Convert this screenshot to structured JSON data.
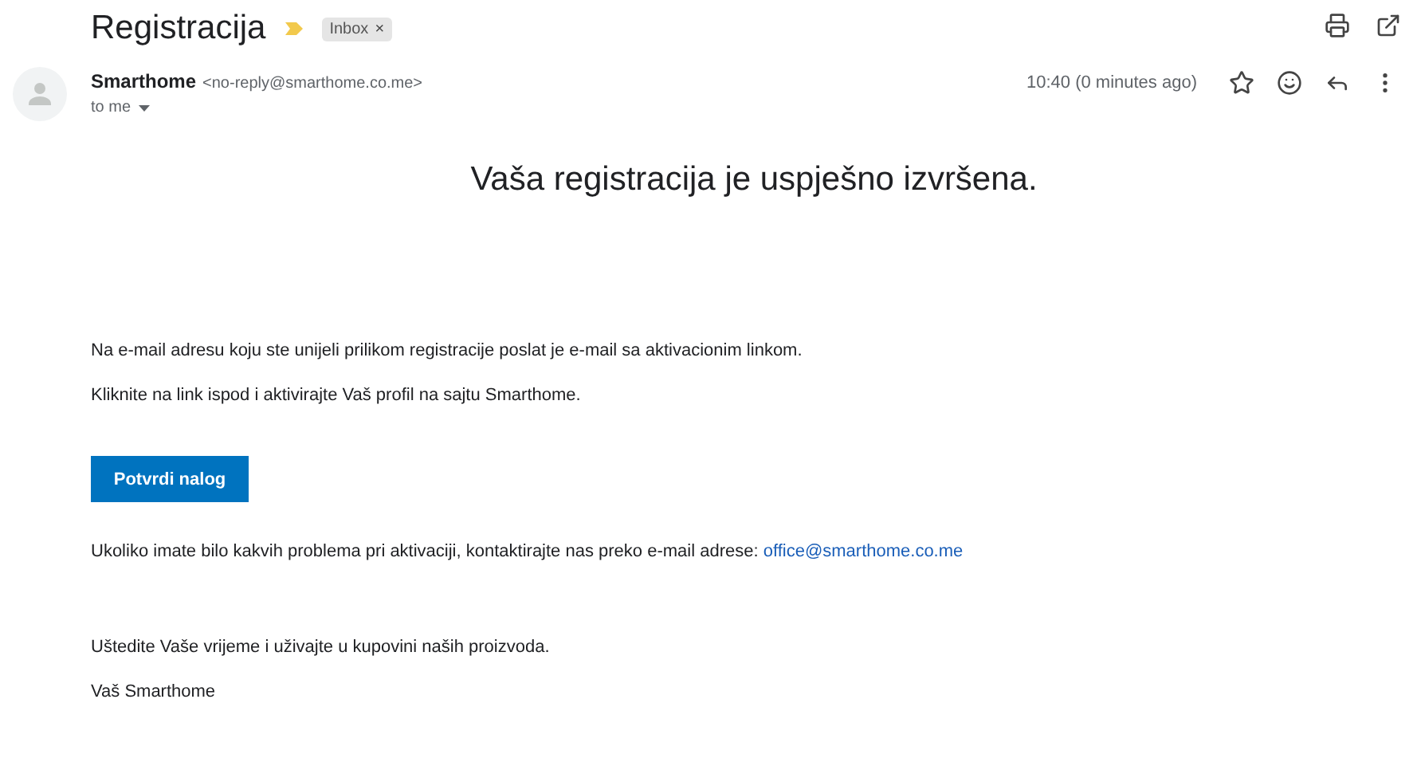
{
  "subject": "Registracija",
  "label": {
    "text": "Inbox",
    "remove": "×"
  },
  "sender": {
    "name": "Smarthome",
    "address": "<no-reply@smarthome.co.me>",
    "recipient": "to me",
    "time": "10:40 (0 minutes ago)"
  },
  "body": {
    "heading": "Vaša registracija je uspješno izvršena.",
    "paragraphs": [
      "Na e-mail adresu koju ste unijeli prilikom registracije poslat je e-mail sa aktivacionim linkom.",
      "Kliknite na link ispod i aktivirajte Vaš profil na sajtu Smarthome."
    ],
    "button": "Potvrdi nalog",
    "contact": {
      "text": "Ukoliko imate bilo kakvih problema pri aktivaciji, kontaktirajte nas preko e-mail adrese:",
      "link": "office@smarthome.co.me"
    },
    "closing": [
      "Uštedite Vaše vrijeme i uživajte u kupovini naših proizvoda.",
      "Vaš Smarthome"
    ]
  }
}
